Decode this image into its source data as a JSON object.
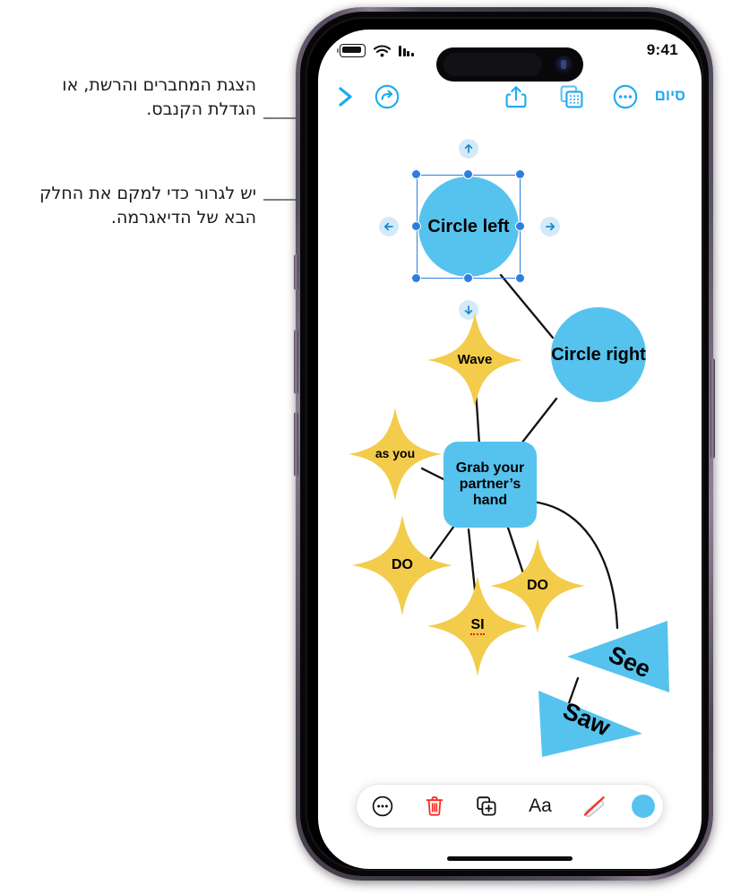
{
  "callouts": [
    {
      "id": "c1",
      "text": "הצגת המחברים והרשת, או הגדלת הקנבס."
    },
    {
      "id": "c2",
      "text": "יש לגרור כדי למקם את החלק הבא של הדיאגרמה."
    }
  ],
  "status_bar": {
    "time": "9:41",
    "battery_icon": "battery-full-icon",
    "wifi_icon": "wifi-icon",
    "cellular_icon": "cellular-bars-icon"
  },
  "app_toolbar": {
    "done_label": "סיום",
    "items": [
      {
        "name": "more-options-icon",
        "label": "עוד"
      },
      {
        "name": "layers-grid-icon",
        "label": "מחברים ורשת"
      },
      {
        "name": "share-icon",
        "label": "שיתוף"
      },
      {
        "name": "redo-icon",
        "label": "ביצוע חוזר"
      },
      {
        "name": "chevron-right-icon",
        "label": "הבא"
      }
    ]
  },
  "canvas": {
    "selected_node": "Circle left",
    "nodes": [
      {
        "id": "circle-left",
        "label": "Circle left",
        "shape": "circle",
        "color": "#56c3ee",
        "selected": true
      },
      {
        "id": "circle-right",
        "label": "Circle right",
        "shape": "circle",
        "color": "#56c3ee",
        "selected": false
      },
      {
        "id": "wave",
        "label": "Wave",
        "shape": "star",
        "color": "#f3cc4c",
        "selected": false
      },
      {
        "id": "as-you",
        "label": "as you",
        "shape": "star",
        "color": "#f3cc4c",
        "selected": false
      },
      {
        "id": "do-left",
        "label": "DO",
        "shape": "star",
        "color": "#f3cc4c",
        "selected": false
      },
      {
        "id": "do-right",
        "label": "DO",
        "shape": "star",
        "color": "#f3cc4c",
        "selected": false
      },
      {
        "id": "si",
        "label": "SI",
        "shape": "star",
        "color": "#f3cc4c",
        "selected": false,
        "misspelled": true
      },
      {
        "id": "grab",
        "label": "Grab your partner’s hand",
        "shape": "rounded-rect",
        "color": "#56c3ee",
        "selected": false
      },
      {
        "id": "see",
        "label": "See",
        "shape": "triangle",
        "color": "#56c3ee",
        "selected": false
      },
      {
        "id": "saw",
        "label": "Saw",
        "shape": "triangle",
        "color": "#56c3ee",
        "selected": false
      }
    ],
    "selection_handles": [
      "nw",
      "n",
      "ne",
      "w",
      "e",
      "sw",
      "s",
      "se"
    ],
    "nudge_arrows": [
      "up",
      "right",
      "down",
      "left"
    ]
  },
  "bottom_toolbar": {
    "items": [
      {
        "name": "more-options-icon",
        "label": "עוד",
        "color": "#111111"
      },
      {
        "name": "trash-icon",
        "label": "מחיקה",
        "color": "#fa2a1e"
      },
      {
        "name": "duplicate-icon",
        "label": "שכפול",
        "color": "#111111"
      },
      {
        "name": "text-style-icon",
        "label": "Aa",
        "color": "#111111"
      },
      {
        "name": "no-stroke-icon",
        "label": "ללא קו",
        "color": "#fa2a1e"
      },
      {
        "name": "color-swatch",
        "label": "צבע",
        "color": "#56c3ee"
      }
    ]
  },
  "theme": {
    "accent_blue": "#1eaaf1",
    "shape_blue": "#56c3ee",
    "shape_yellow": "#f3cc4c",
    "selection_blue": "#2b7fe0",
    "delete_red": "#fa2a1e"
  }
}
